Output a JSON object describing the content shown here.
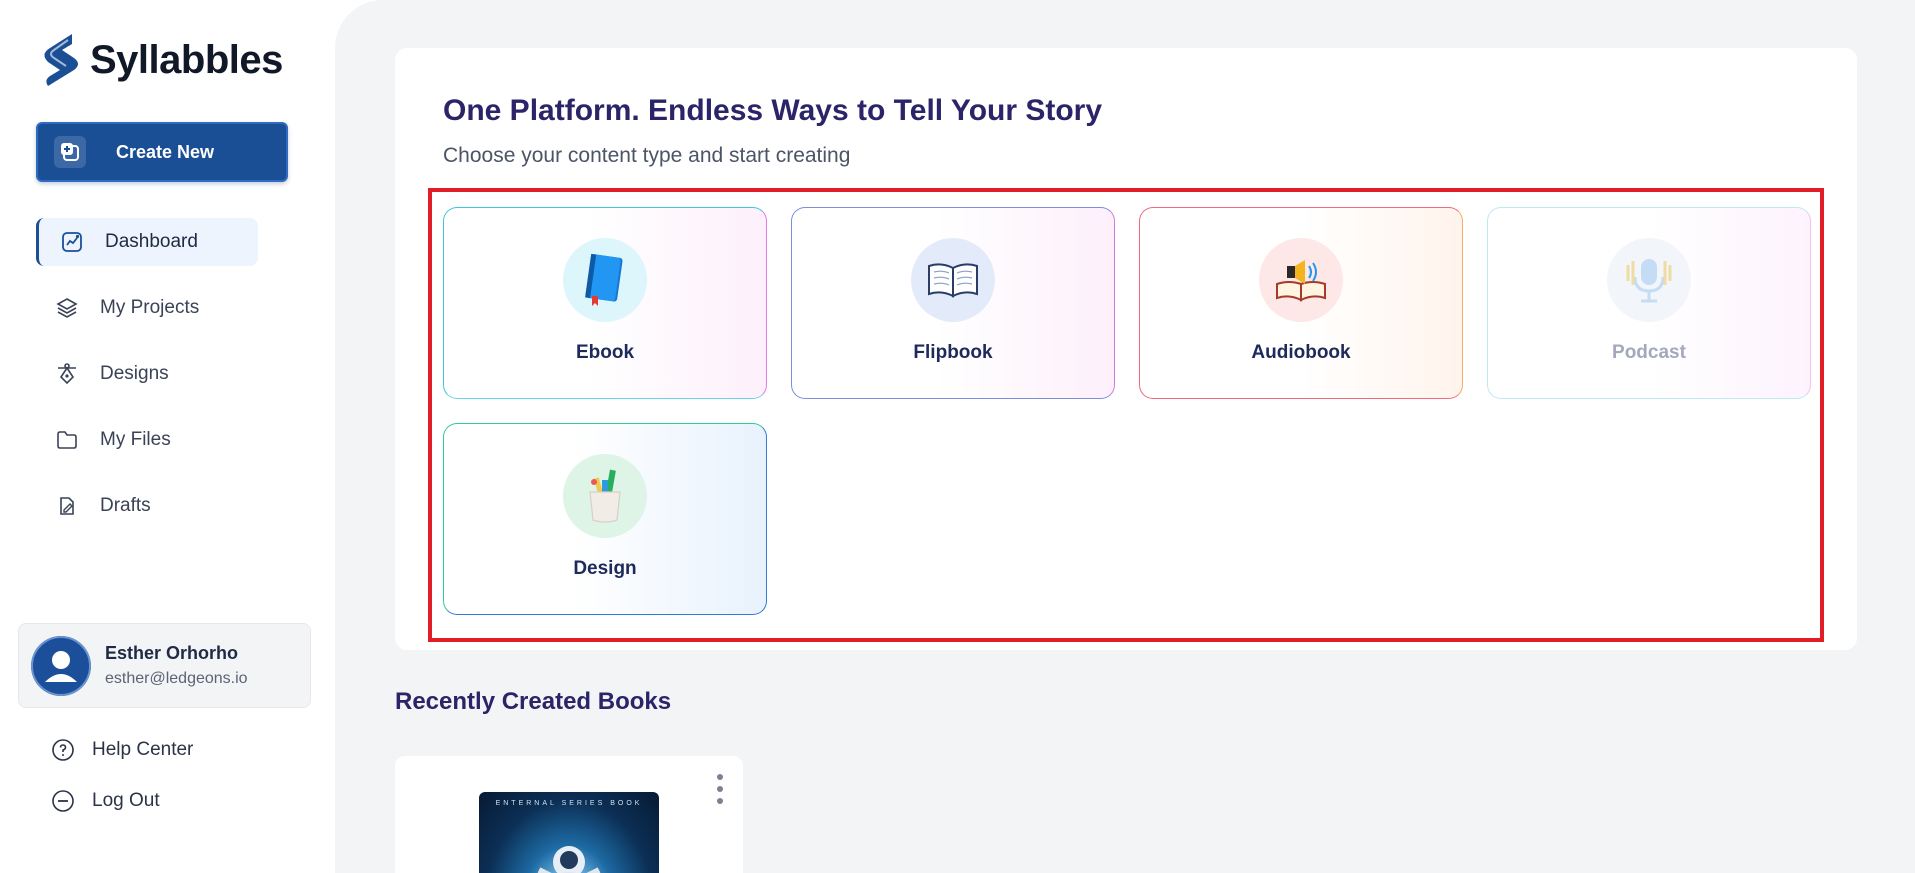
{
  "brand": {
    "name": "Syllabbles"
  },
  "sidebar": {
    "create_label": "Create New",
    "items": [
      {
        "label": "Dashboard",
        "icon": "chart-icon"
      },
      {
        "label": "My Projects",
        "icon": "layers-icon"
      },
      {
        "label": "Designs",
        "icon": "pen-tool-icon"
      },
      {
        "label": "My Files",
        "icon": "folder-icon"
      },
      {
        "label": "Drafts",
        "icon": "draft-icon"
      }
    ],
    "user": {
      "name": "Esther Orhorho",
      "email": "esther@ledgeons.io"
    },
    "help_label": "Help Center",
    "logout_label": "Log Out"
  },
  "main": {
    "title": "One Platform. Endless Ways to Tell Your Story",
    "subtitle": "Choose your content type and start creating",
    "content_types": [
      {
        "label": "Ebook",
        "icon": "blue-book-icon"
      },
      {
        "label": "Flipbook",
        "icon": "open-book-icon"
      },
      {
        "label": "Audiobook",
        "icon": "speaker-book-icon"
      },
      {
        "label": "Podcast",
        "icon": "microphone-icon"
      },
      {
        "label": "Design",
        "icon": "pencil-cup-icon"
      }
    ],
    "recent_title": "Recently Created Books",
    "recent_books": [
      {
        "cover_text": "ENTERNAL SERIES BOOK"
      }
    ]
  },
  "colors": {
    "brand_blue": "#1a4f96",
    "title_purple": "#2b2468",
    "highlight_red": "#e11d26",
    "main_bg": "#f3f4f6"
  }
}
